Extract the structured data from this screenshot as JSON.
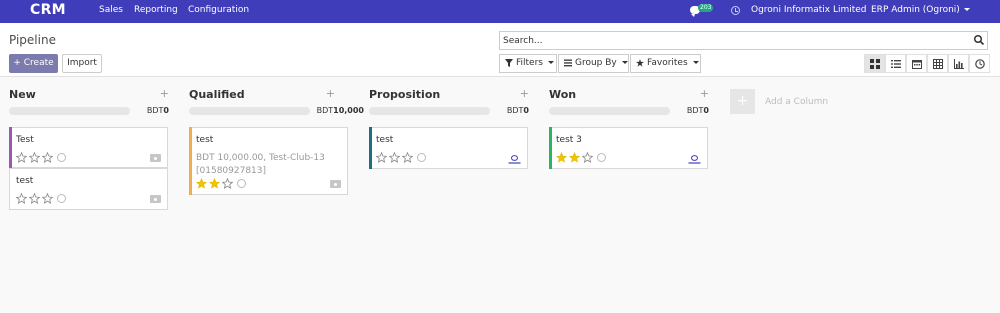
{
  "navbar": {
    "brand": "CRM",
    "menu": [
      "Sales",
      "Reporting",
      "Configuration"
    ],
    "message_count": "203",
    "company": "Ogroni Informatix Limited",
    "user": "ERP Admin (Ogroni)",
    "bar_color": "#3f3db9"
  },
  "control_panel": {
    "title": "Pipeline",
    "create_label": "Create",
    "import_label": "Import",
    "search_placeholder": "Search...",
    "filters_label": "Filters",
    "group_by_label": "Group By",
    "favorites_label": "Favorites",
    "views": [
      "kanban-icon",
      "list-icon",
      "calendar-icon",
      "pivot-icon",
      "graph-icon",
      "activity-icon"
    ],
    "active_view": "kanban-icon"
  },
  "columns": [
    {
      "title": "New",
      "currency": "BDT",
      "total": "0",
      "cards": [
        {
          "title": "Test",
          "lines": [],
          "stars": 0,
          "accent": "#9b59b6",
          "icon": "camera-icon"
        },
        {
          "title": "test",
          "lines": [],
          "stars": 0,
          "accent": "",
          "icon": "camera-icon"
        }
      ]
    },
    {
      "title": "Qualified",
      "currency": "BDT",
      "total": "10,000",
      "cards": [
        {
          "title": "test",
          "lines": [
            "BDT 10,000.00, Test-Club-13",
            "[01580927813]"
          ],
          "stars": 2,
          "accent": "#f0ad4e",
          "icon": "camera-icon"
        }
      ]
    },
    {
      "title": "Proposition",
      "currency": "BDT",
      "total": "0",
      "cards": [
        {
          "title": "test",
          "lines": [],
          "stars": 0,
          "accent": "#1f6f7f",
          "icon": "avatar-icon"
        }
      ]
    },
    {
      "title": "Won",
      "currency": "BDT",
      "total": "0",
      "cards": [
        {
          "title": "test 3",
          "lines": [],
          "stars": 2,
          "accent": "#28b463",
          "icon": "avatar-icon"
        }
      ]
    }
  ],
  "add_column_label": "Add a Column",
  "star_color": "#f3c300"
}
